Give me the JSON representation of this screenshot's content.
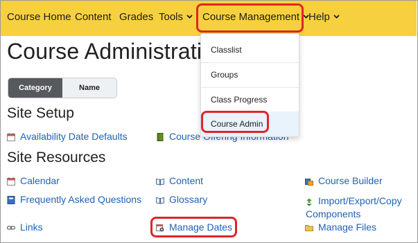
{
  "nav": {
    "items": [
      {
        "label": "Course Home"
      },
      {
        "label": "Content"
      },
      {
        "label": "Grades"
      },
      {
        "label": "Tools"
      },
      {
        "label": "Course Management"
      },
      {
        "label": "Help"
      }
    ],
    "bar_color": "#f6d03f"
  },
  "dropdown": {
    "items": [
      {
        "label": "Classlist"
      },
      {
        "label": "Groups"
      },
      {
        "label": "Class Progress"
      },
      {
        "label": "Course Admin"
      }
    ],
    "selected": "Course Admin"
  },
  "page": {
    "title": "Course Administration"
  },
  "view_toggle": {
    "category_label": "Category",
    "name_label": "Name",
    "active": "Category"
  },
  "site_setup": {
    "heading": "Site Setup",
    "links": [
      {
        "label": "Availability Date Defaults",
        "icon": "calendar-icon"
      },
      {
        "label": "Course Offering Information",
        "icon": "book-icon"
      }
    ]
  },
  "site_resources": {
    "heading": "Site Resources",
    "links": [
      {
        "label": "Calendar",
        "icon": "calendar-icon"
      },
      {
        "label": "Content",
        "icon": "open-book-icon"
      },
      {
        "label": "Course Builder",
        "icon": "course-builder-icon"
      },
      {
        "label": "Frequently Asked Questions",
        "icon": "faq-icon"
      },
      {
        "label": "Glossary",
        "icon": "open-book-icon"
      },
      {
        "label": "Import/Export/Copy",
        "label_line2": "Components",
        "icon": "import-export-icon"
      },
      {
        "label": "Links",
        "icon": "chain-link-icon"
      },
      {
        "label": "Manage Dates",
        "icon": "gear-calendar-icon"
      },
      {
        "label": "Manage Files",
        "icon": "folder-icon"
      }
    ]
  },
  "colors": {
    "link": "#1e62b4",
    "highlight": "#e0242a",
    "toggle_active": "#565a5c"
  }
}
